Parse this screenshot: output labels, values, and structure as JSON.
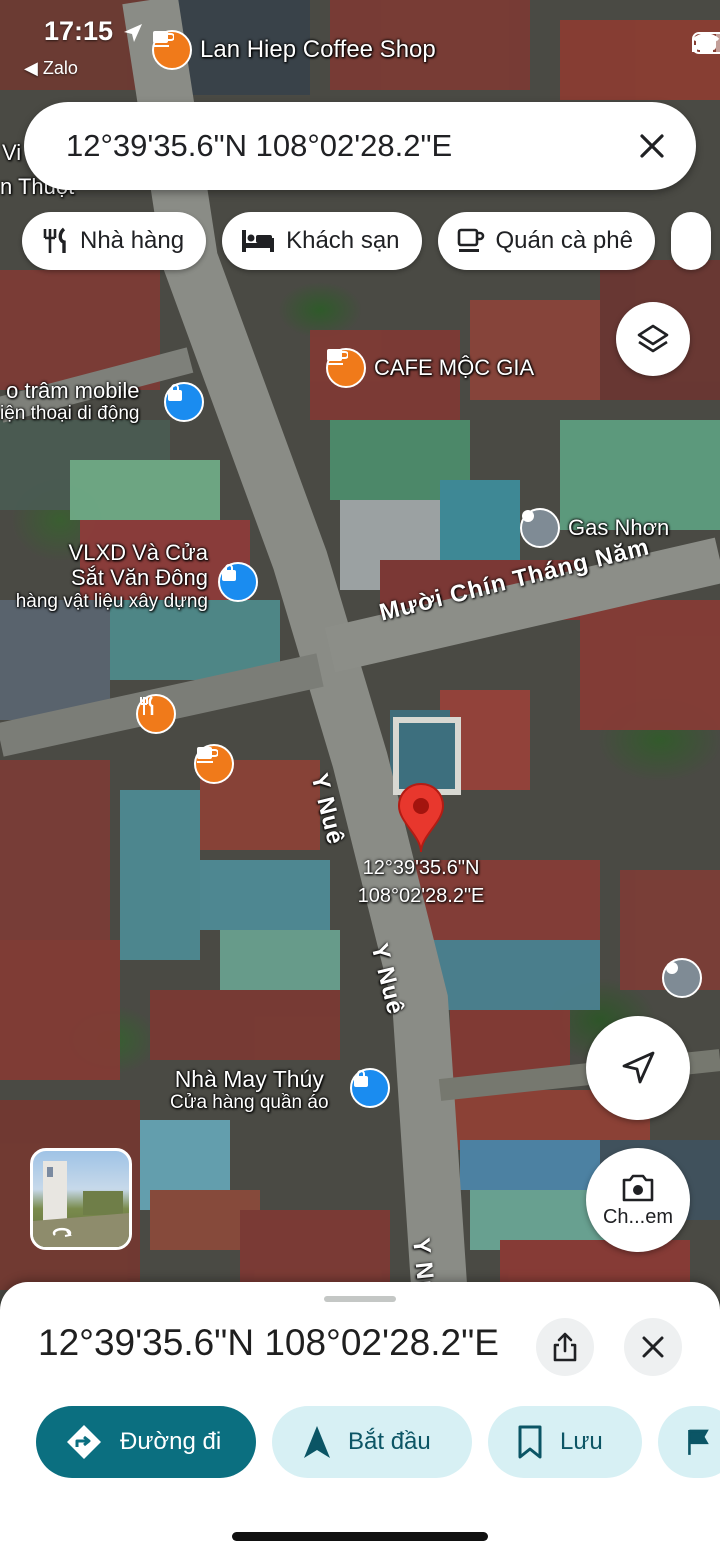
{
  "status_bar": {
    "time": "17:15",
    "back_app": "◀ Zalo"
  },
  "search": {
    "query": "12°39'35.6\"N 108°02'28.2\"E"
  },
  "chips": [
    {
      "label": "Nhà hàng",
      "icon": "restaurant-icon"
    },
    {
      "label": "Khách sạn",
      "icon": "hotel-icon"
    },
    {
      "label": "Quán cà phê",
      "icon": "coffee-icon"
    }
  ],
  "map": {
    "pois": {
      "lan_hiep": "Lan Hiep Coffee Shop",
      "vi_thuot_1": "Vi",
      "vi_thuot_2": "n Thuột",
      "cafe_moc_gia": "CAFE MỘC GIA",
      "tram_mobile": "o trâm mobile",
      "tram_mobile_sub": "iện thoại di động",
      "gas_nhon": "Gas Nhơn",
      "vlxd_1": "VLXD Và Cửa",
      "vlxd_2": "Sắt Văn Đông",
      "vlxd_sub": "hàng vật liệu xây dựng",
      "nha_may_thuy": "Nhà May Thúy",
      "nha_may_thuy_sub": "Cửa hàng quần áo"
    },
    "streets": {
      "muoi_chin": "Mười Chín Tháng Năm",
      "y_nue_1": "Y Nuê",
      "y_nue_2": "Y Nuê",
      "y_nue_3": "Y Nu"
    },
    "pin_lat": "12°39'35.6\"N",
    "pin_lng": "108°02'28.2\"E",
    "camera_label": "Ch...em",
    "colors": {
      "coffee": "#f07a1a",
      "shop": "#1a8cf0",
      "generic": "#7f8b95",
      "pin": "#e8372d"
    }
  },
  "sheet": {
    "title": "12°39'35.6\"N 108°02'28.2\"E",
    "actions": [
      {
        "label": "Đường đi",
        "icon": "directions-icon",
        "primary": true
      },
      {
        "label": "Bắt đầu",
        "icon": "navigation-arrow-icon"
      },
      {
        "label": "Lưu",
        "icon": "bookmark-icon"
      }
    ],
    "accent": "#0b6f80"
  }
}
